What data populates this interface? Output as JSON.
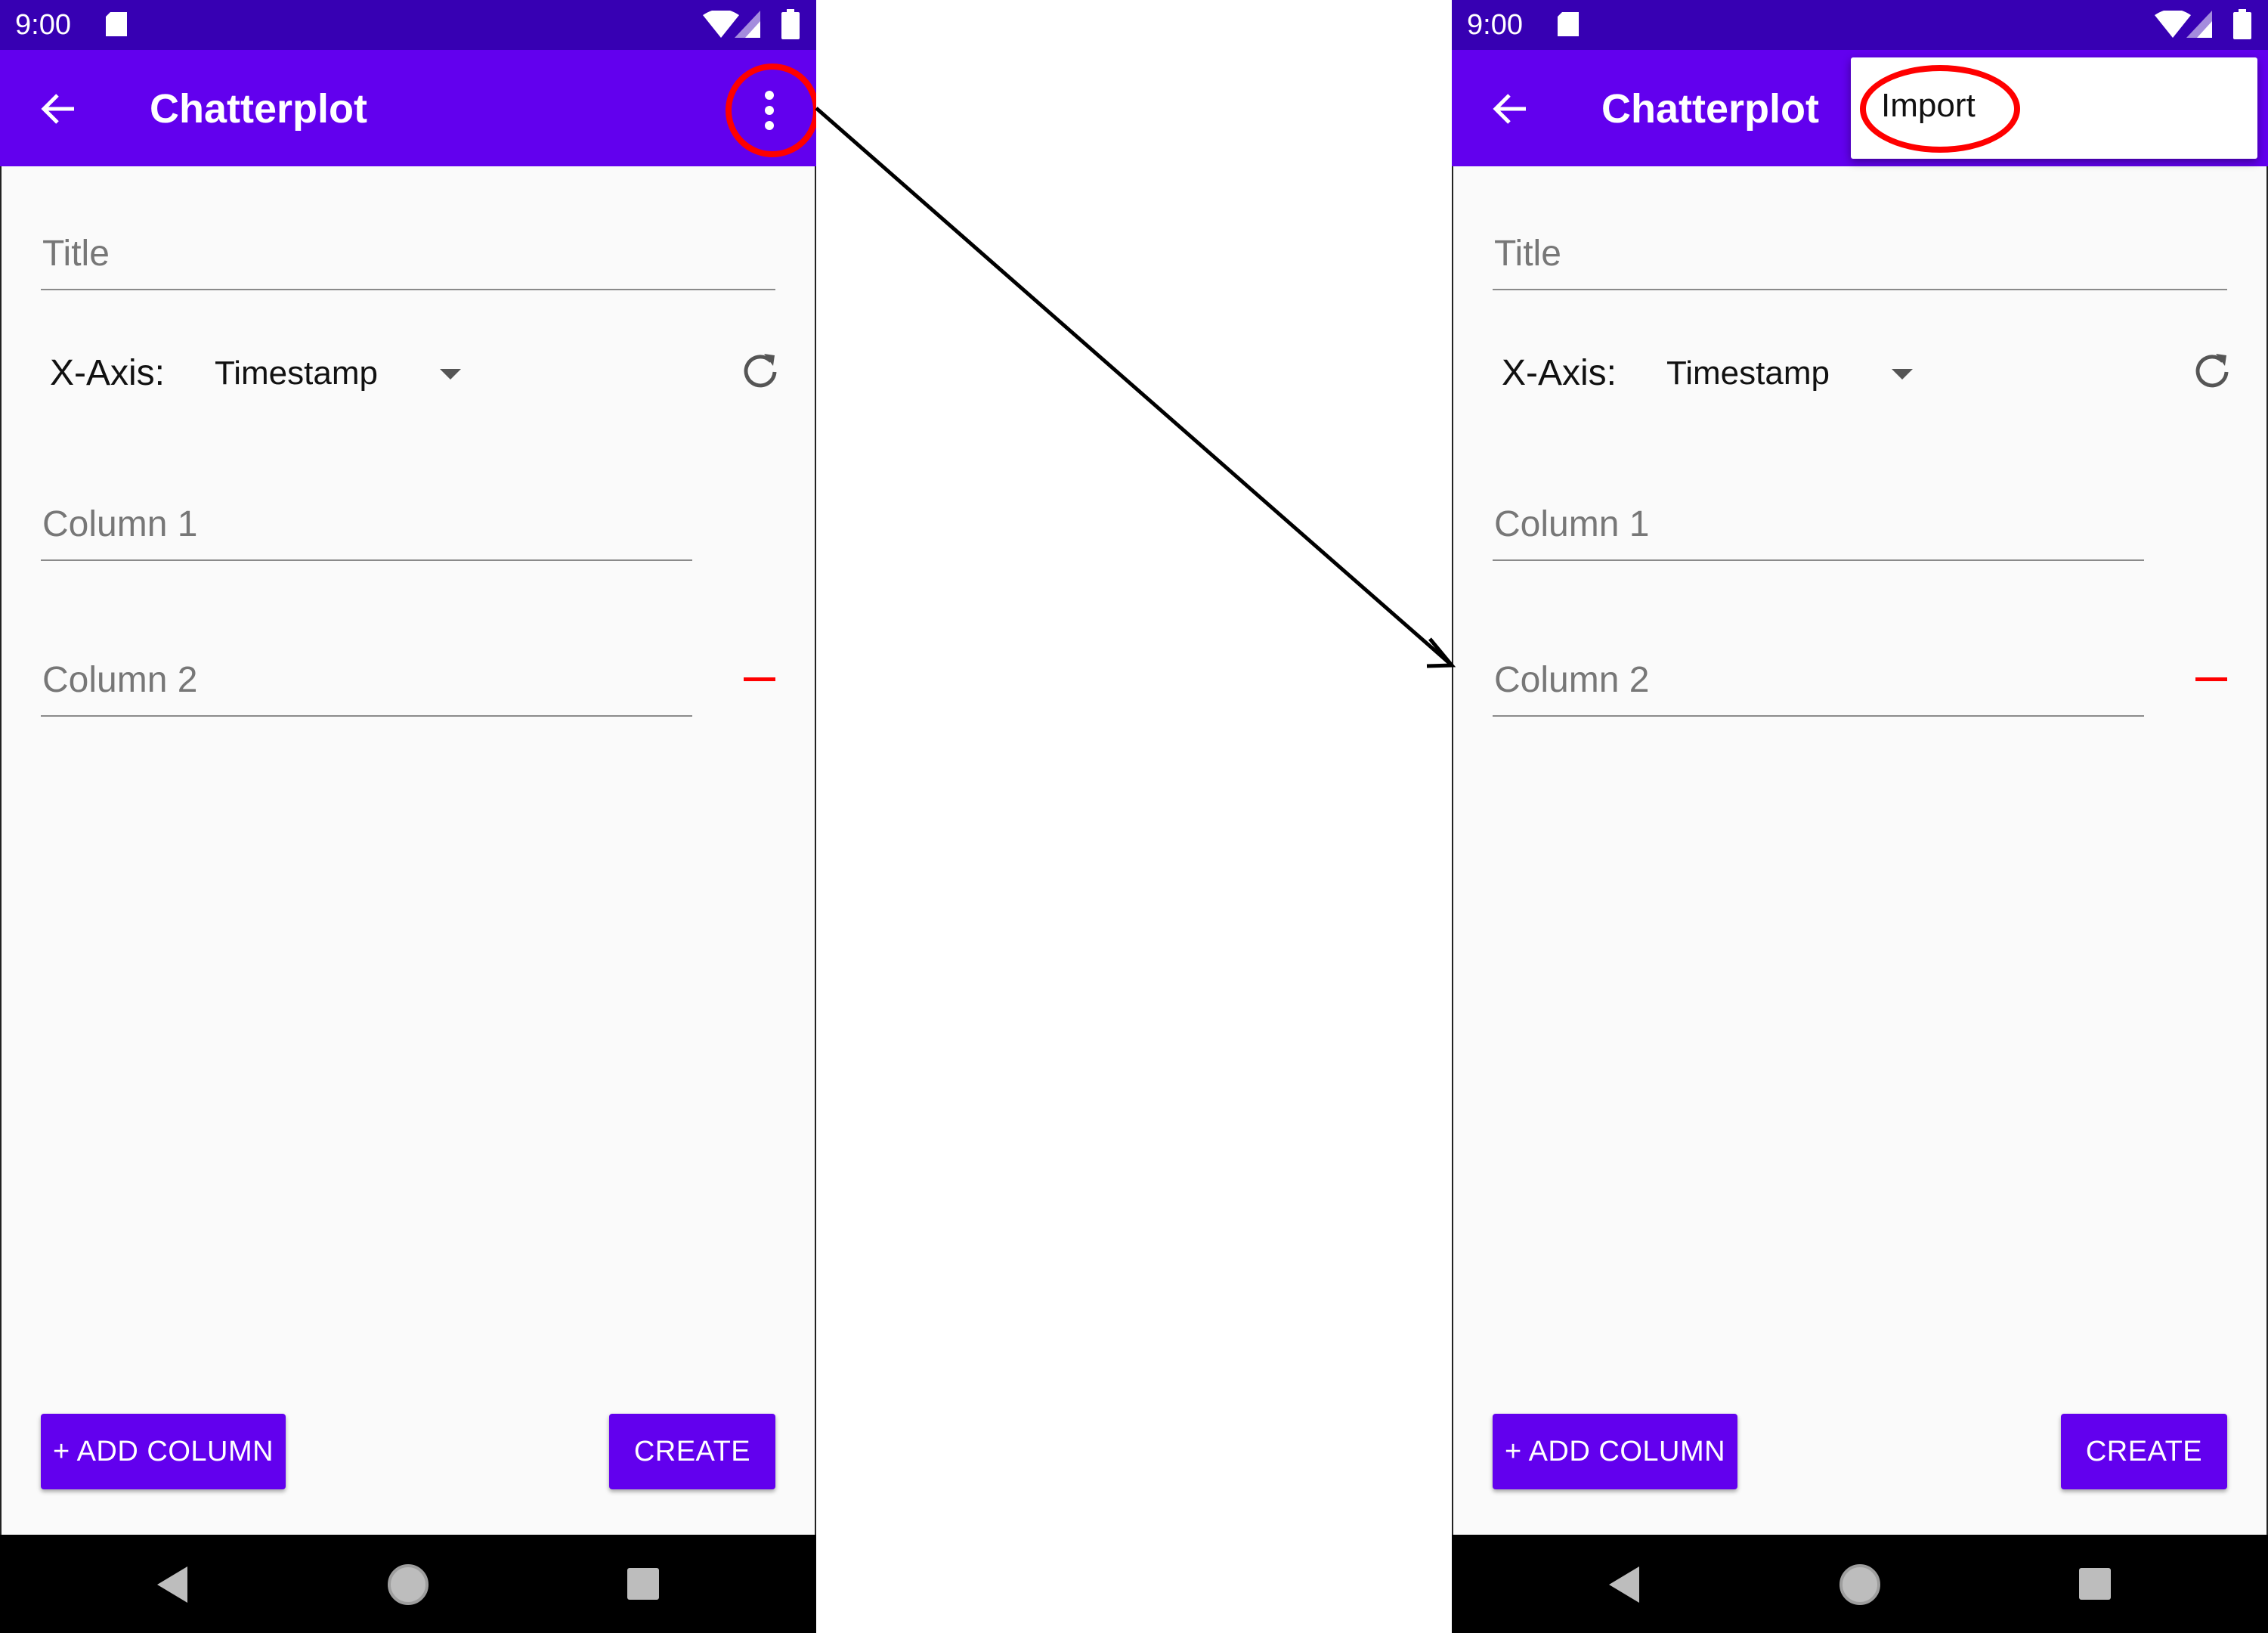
{
  "status_bar": {
    "time": "9:00"
  },
  "app_bar": {
    "title": "Chatterplot"
  },
  "form": {
    "title_hint": "Title",
    "xaxis_label": "X-Axis:",
    "xaxis_value": "Timestamp",
    "columns": [
      {
        "hint": "Column 1"
      },
      {
        "hint": "Column 2"
      }
    ]
  },
  "buttons": {
    "add_column": "+ ADD COLUMN",
    "create": "CREATE"
  },
  "menu": {
    "import": "Import"
  },
  "colors": {
    "status_bar": "#3700b3",
    "app_bar": "#6200ee",
    "accent": "#6200ee",
    "annotation": "#ff0000",
    "remove": "#ff0000"
  },
  "icons": {
    "back": "arrow-left-icon",
    "more": "more-vert-icon",
    "refresh": "refresh-icon",
    "remove": "minus-icon",
    "nav_back": "triangle-back-icon",
    "nav_home": "circle-home-icon",
    "nav_recents": "square-recents-icon"
  }
}
